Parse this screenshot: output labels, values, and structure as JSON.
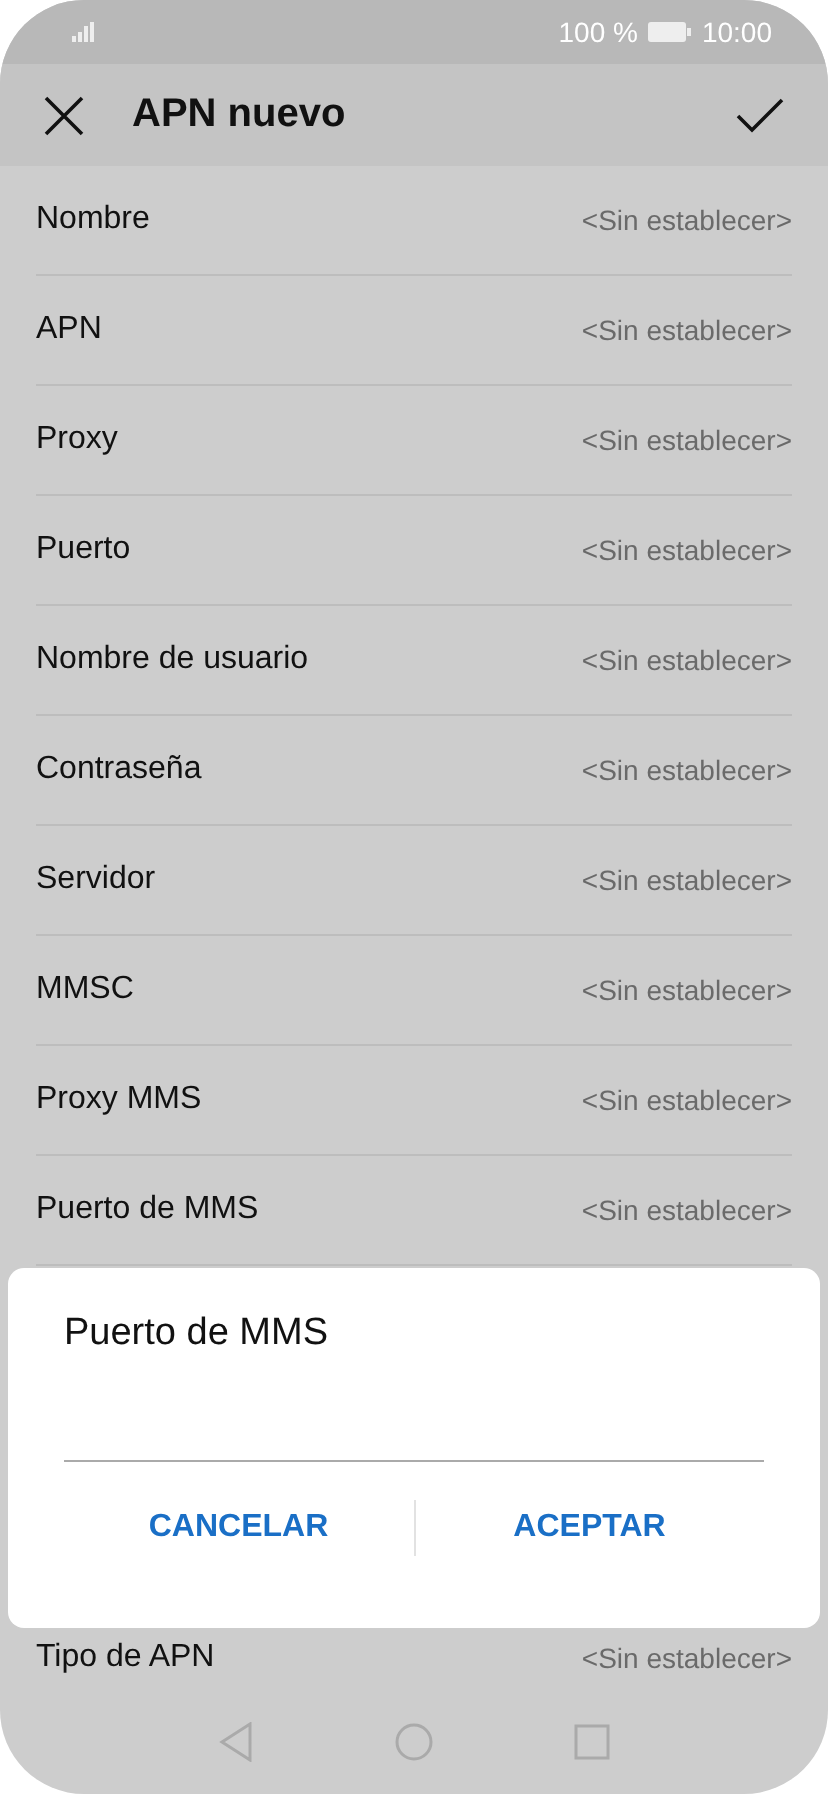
{
  "status_bar": {
    "battery": "100 %",
    "time": "10:00"
  },
  "toolbar": {
    "title": "APN nuevo"
  },
  "settings": [
    {
      "label": "Nombre",
      "value": "<Sin establecer>"
    },
    {
      "label": "APN",
      "value": "<Sin establecer>"
    },
    {
      "label": "Proxy",
      "value": "<Sin establecer>"
    },
    {
      "label": "Puerto",
      "value": "<Sin establecer>"
    },
    {
      "label": "Nombre de usuario",
      "value": "<Sin establecer>"
    },
    {
      "label": "Contraseña",
      "value": "<Sin establecer>"
    },
    {
      "label": "Servidor",
      "value": "<Sin establecer>"
    },
    {
      "label": "MMSC",
      "value": "<Sin establecer>"
    },
    {
      "label": "Proxy MMS",
      "value": "<Sin establecer>"
    },
    {
      "label": "Puerto de MMS",
      "value": "<Sin establecer>"
    }
  ],
  "bottom_settings": [
    {
      "label": "Tipo de APN",
      "value": "<Sin establecer>"
    }
  ],
  "dialog": {
    "title": "Puerto de MMS",
    "buttons": [
      "CANCELAR",
      "ACEPTAR"
    ]
  }
}
